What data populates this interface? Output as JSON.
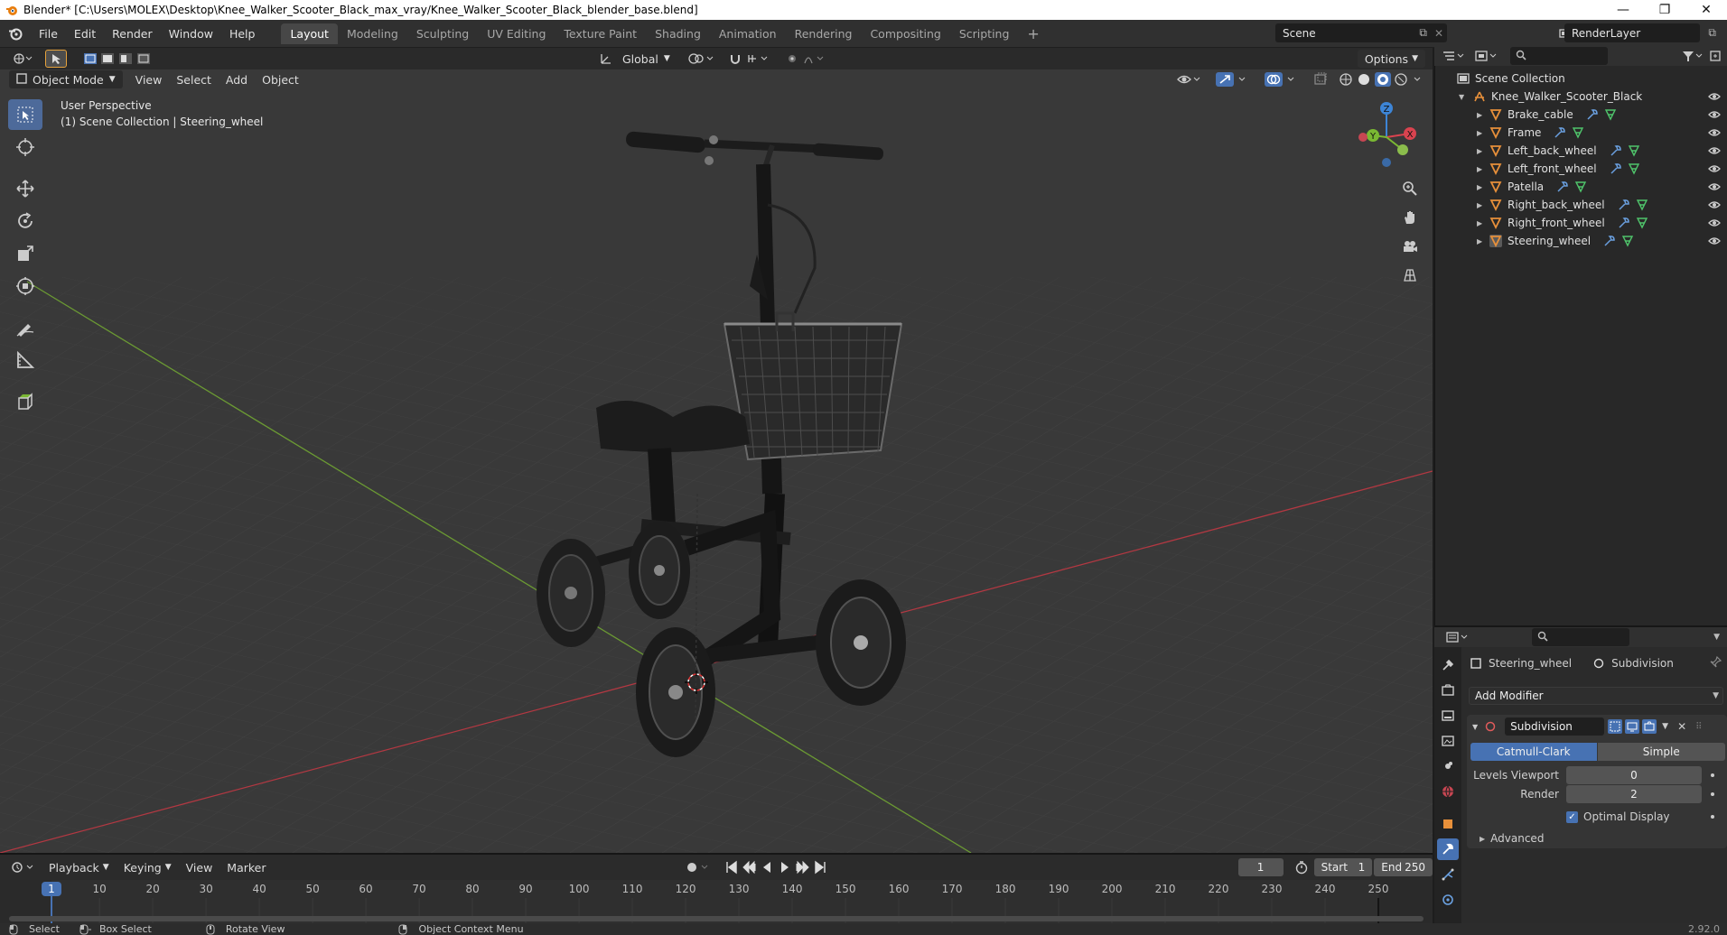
{
  "window": {
    "title": "Blender* [C:\\Users\\MOLEX\\Desktop\\Knee_Walker_Scooter_Black_max_vray/Knee_Walker_Scooter_Black_blender_base.blend]",
    "minimize": "—",
    "maximize": "❐",
    "close": "✕"
  },
  "menubar": {
    "items": [
      "File",
      "Edit",
      "Render",
      "Window",
      "Help"
    ],
    "workspaces": [
      "Layout",
      "Modeling",
      "Sculpting",
      "UV Editing",
      "Texture Paint",
      "Shading",
      "Animation",
      "Rendering",
      "Compositing",
      "Scripting"
    ],
    "active_workspace": "Layout",
    "add_workspace": "+",
    "scene": "Scene",
    "view_layer": "RenderLayer"
  },
  "viewport_header": {
    "transform_orientation": "Global",
    "options": "Options",
    "mode": "Object Mode",
    "menus": [
      "View",
      "Select",
      "Add",
      "Object"
    ]
  },
  "viewport": {
    "perspective": "User Perspective",
    "context": "(1) Scene Collection | Steering_wheel",
    "gizmo": {
      "x": "X",
      "y": "Y",
      "z": "Z"
    }
  },
  "outliner": {
    "root": "Scene Collection",
    "collection": "Knee_Walker_Scooter_Black",
    "objects": [
      "Brake_cable",
      "Frame",
      "Left_back_wheel",
      "Left_front_wheel",
      "Patella",
      "Right_back_wheel",
      "Right_front_wheel",
      "Steering_wheel"
    ]
  },
  "properties": {
    "object_name": "Steering_wheel",
    "modifier_breadcrumb": "Subdivision",
    "add_modifier": "Add Modifier",
    "modifier_name": "Subdivision",
    "algorithms": [
      "Catmull-Clark",
      "Simple"
    ],
    "active_algorithm": "Catmull-Clark",
    "levels_viewport_label": "Levels Viewport",
    "levels_viewport_value": "0",
    "render_label": "Render",
    "render_value": "2",
    "optimal_display_label": "Optimal Display",
    "optimal_display_checked": true,
    "advanced_label": "Advanced"
  },
  "timeline": {
    "menus": [
      "Playback",
      "Keying",
      "View",
      "Marker"
    ],
    "current_frame": "1",
    "start_label": "Start",
    "start_value": "1",
    "end_label": "End",
    "end_value": "250",
    "ruler": [
      "1",
      "10",
      "20",
      "30",
      "40",
      "50",
      "60",
      "70",
      "80",
      "90",
      "100",
      "110",
      "120",
      "130",
      "140",
      "150",
      "160",
      "170",
      "180",
      "190",
      "200",
      "210",
      "220",
      "230",
      "240",
      "250"
    ]
  },
  "statusbar": {
    "items": [
      "Select",
      "Box Select",
      "Rotate View",
      "Object Context Menu"
    ],
    "version": "2.92.0"
  },
  "colors": {
    "accent": "#4772b3",
    "x_axis": "#d9434f",
    "y_axis": "#7ab833",
    "z_axis": "#3d85d6",
    "object_icon": "#e8903a"
  }
}
